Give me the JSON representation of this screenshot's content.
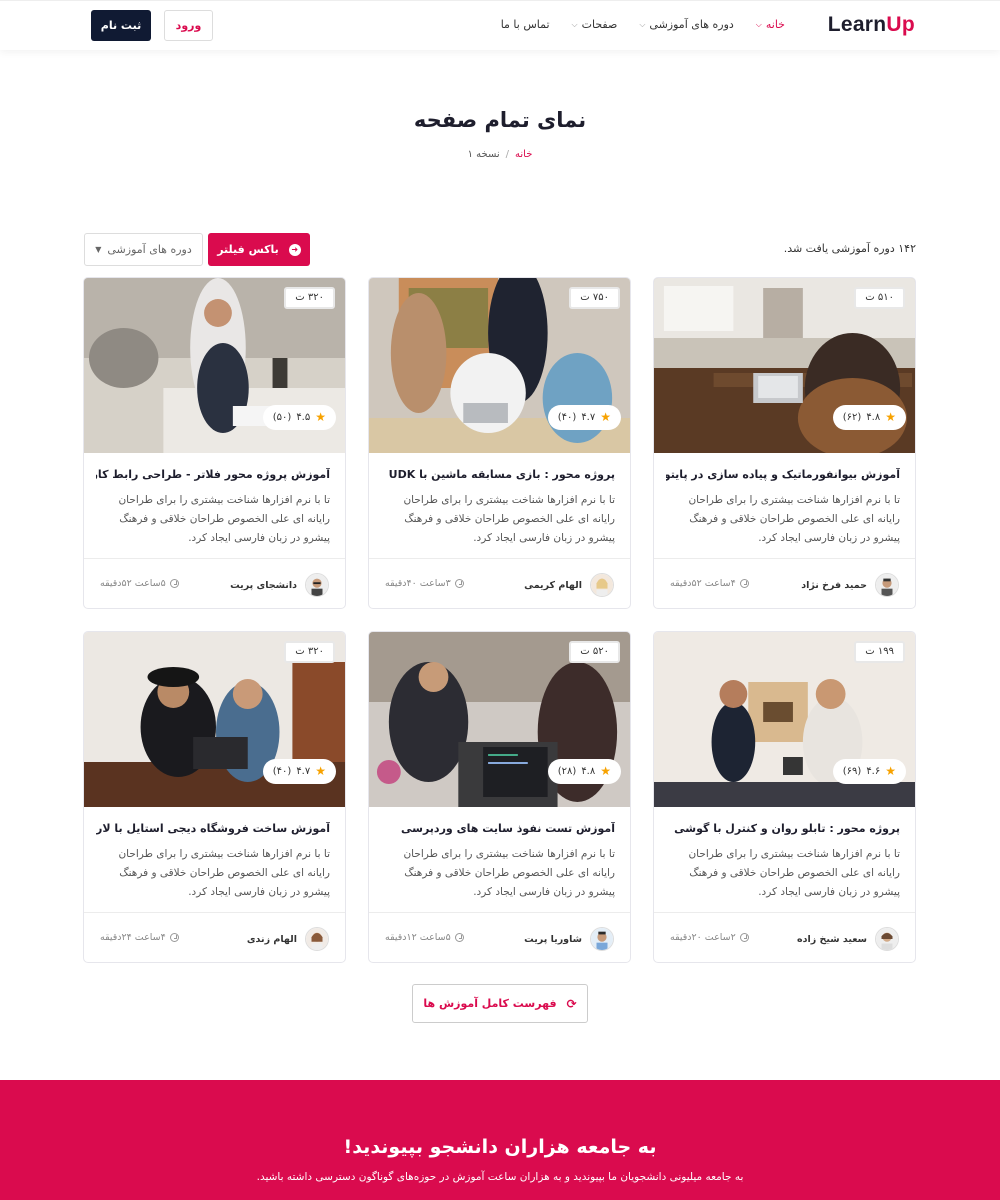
{
  "header": {
    "logo_part1": "Learn",
    "logo_part2": "Up",
    "nav": [
      {
        "label": "خانه",
        "has_dropdown": true,
        "active": true
      },
      {
        "label": "دوره های آموزشی",
        "has_dropdown": true,
        "active": false
      },
      {
        "label": "صفحات",
        "has_dropdown": true,
        "active": false
      },
      {
        "label": "تماس با ما",
        "has_dropdown": false,
        "active": false
      }
    ],
    "login_label": "ورود",
    "signup_label": "ثبت نام"
  },
  "page": {
    "title": "نمای تمام صفحه",
    "breadcrumb_home": "خانه",
    "breadcrumb_current": "نسخه ۱"
  },
  "filters": {
    "found_text": "۱۴۲ دوره آموزشی یافت شد.",
    "filter_button": "باکس فیلتر",
    "category_select": "دوره های آموزشی"
  },
  "courses": [
    {
      "price": "۵۱۰ ت",
      "rating": "۴.۸",
      "reviews": "(۶۲)",
      "title": "آموزش بیوانفورماتیک و پیاده سازی در پایتون",
      "description": "تا با نرم افزارها شناخت بیشتری را برای طراحان رایانه ای علی الخصوص طراحان خلاقی و فرهنگ پیشرو در زبان فارسی ایجاد کرد.",
      "author": "حمید فرخ نژاد",
      "duration": "۴ساعت ۵۲دقیقه"
    },
    {
      "price": "۷۵۰ ت",
      "rating": "۴.۷",
      "reviews": "(۴۰)",
      "title": "پروژه محور : بازی مسابقه ماشین با UDK",
      "description": "تا با نرم افزارها شناخت بیشتری را برای طراحان رایانه ای علی الخصوص طراحان خلاقی و فرهنگ پیشرو در زبان فارسی ایجاد کرد.",
      "author": "الهام کریمی",
      "duration": "۳ساعت ۴۰دقیقه"
    },
    {
      "price": "۳۲۰ ت",
      "rating": "۴.۵",
      "reviews": "(۵۰)",
      "title": "آموزش پروژه محور فلاتر - طراحی رابط کاربری UI",
      "description": "تا با نرم افزارها شناخت بیشتری را برای طراحان رایانه ای علی الخصوص طراحان خلاقی و فرهنگ پیشرو در زبان فارسی ایجاد کرد.",
      "author": "دانشجای پریت",
      "duration": "۵ساعت ۵۲دقیقه"
    },
    {
      "price": "۱۹۹ ت",
      "rating": "۴.۶",
      "reviews": "(۶۹)",
      "title": "پروژه محور : تابلو روان و کنترل با گوشی",
      "description": "تا با نرم افزارها شناخت بیشتری را برای طراحان رایانه ای علی الخصوص طراحان خلاقی و فرهنگ پیشرو در زبان فارسی ایجاد کرد.",
      "author": "سعید شیخ زاده",
      "duration": "۲ساعت ۲۰دقیقه"
    },
    {
      "price": "۵۲۰ ت",
      "rating": "۴.۸",
      "reviews": "(۲۸)",
      "title": "آموزش تست نفوذ سایت های وردپرسی",
      "description": "تا با نرم افزارها شناخت بیشتری را برای طراحان رایانه ای علی الخصوص طراحان خلاقی و فرهنگ پیشرو در زبان فارسی ایجاد کرد.",
      "author": "شاوریا پریت",
      "duration": "۵ساعت ۱۲دقیقه"
    },
    {
      "price": "۳۲۰ ت",
      "rating": "۴.۷",
      "reviews": "(۴۰)",
      "title": "آموزش ساخت فروشگاه دیجی استایل با لاراول",
      "description": "تا با نرم افزارها شناخت بیشتری را برای طراحان رایانه ای علی الخصوص طراحان خلاقی و فرهنگ پیشرو در زبان فارسی ایجاد کرد.",
      "author": "الهام زندی",
      "duration": "۴ساعت ۲۴دقیقه"
    }
  ],
  "full_list_button": "فهرست کامل آموزش ها",
  "cta": {
    "heading": "به جامعه هزاران دانشجو بپیوندید!",
    "text": "به جامعه میلیونی دانشجویان ما بپیوندید و به هزاران ساعت آموزش در حوزه‌های گوناگون دسترسی داشته باشید."
  },
  "colors": {
    "accent": "#da0b4e",
    "dark_button": "#101a33",
    "star": "#f7a200"
  }
}
